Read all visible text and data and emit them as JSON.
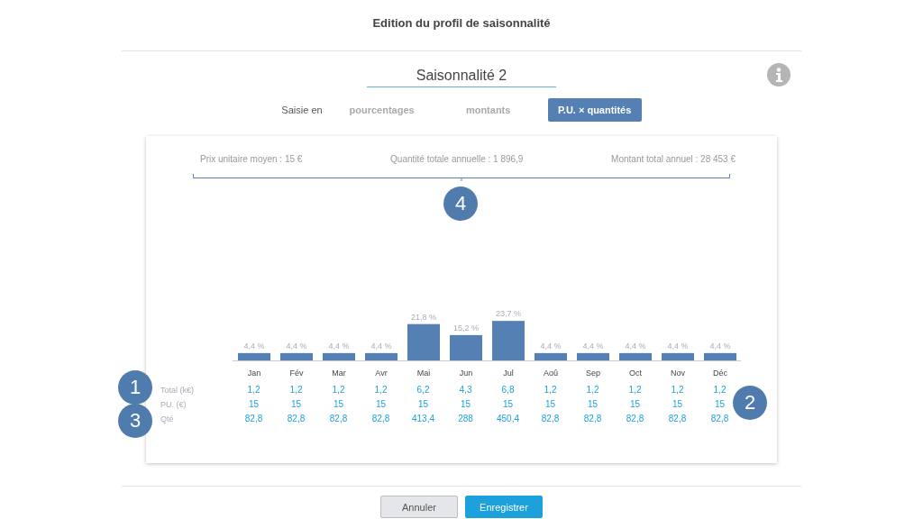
{
  "dialog": {
    "title": "Edition du profil de saisonnalité"
  },
  "profile_name": {
    "value": "Saisonnalité 2"
  },
  "entry_mode": {
    "label": "Saisie en",
    "tabs": [
      {
        "label": "pourcentages",
        "selected": false
      },
      {
        "label": "montants",
        "selected": false
      },
      {
        "label": "P.U. × quantités",
        "selected": true
      }
    ]
  },
  "summary": [
    "Prix unitaire moyen : 15 €",
    "Quantité totale annuelle : 1 896,9",
    "Montant total annuel : 28 453 €"
  ],
  "chart_data": {
    "type": "bar",
    "categories": [
      "Jan",
      "Fév",
      "Mar",
      "Avr",
      "Mai",
      "Jun",
      "Jul",
      "Aoû",
      "Sep",
      "Oct",
      "Nov",
      "Déc"
    ],
    "values": [
      4.4,
      4.4,
      4.4,
      4.4,
      21.8,
      15.2,
      23.7,
      4.4,
      4.4,
      4.4,
      4.4,
      4.4
    ],
    "value_labels": [
      "4,4 %",
      "4,4 %",
      "4,4 %",
      "4,4 %",
      "21,8 %",
      "15,2 %",
      "23,7 %",
      "4,4 %",
      "4,4 %",
      "4,4 %",
      "4,4 %",
      "4,4 %"
    ]
  },
  "table": {
    "rows": [
      {
        "label": "Total (k€)",
        "cells": [
          "1,2",
          "1,2",
          "1,2",
          "1,2",
          "6,2",
          "4,3",
          "6,8",
          "1,2",
          "1,2",
          "1,2",
          "1,2",
          "1,2"
        ]
      },
      {
        "label": "PU. (€)",
        "cells": [
          "15",
          "15",
          "15",
          "15",
          "15",
          "15",
          "15",
          "15",
          "15",
          "15",
          "15",
          "15"
        ]
      },
      {
        "label": "Qté",
        "cells": [
          "82,8",
          "82,8",
          "82,8",
          "82,8",
          "413,4",
          "288",
          "450,4",
          "82,8",
          "82,8",
          "82,8",
          "82,8",
          "82,8"
        ]
      }
    ]
  },
  "callouts": [
    {
      "label": "1"
    },
    {
      "label": "2"
    },
    {
      "label": "3"
    },
    {
      "label": "4"
    }
  ],
  "buttons": [
    {
      "label": "Annuler",
      "kind": "secondary"
    },
    {
      "label": "Enregistrer",
      "kind": "primary"
    }
  ]
}
